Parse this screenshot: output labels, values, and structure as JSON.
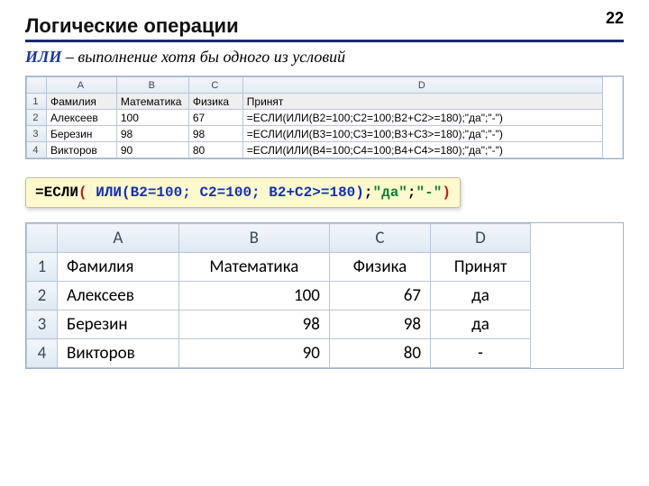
{
  "page_number": "22",
  "title": "Логические операции",
  "subtitle": {
    "keyword": "ИЛИ",
    "rest": " – выполнение хотя бы одного из условий"
  },
  "table_small": {
    "columns": [
      "A",
      "B",
      "C",
      "D"
    ],
    "headers": [
      "Фамилия",
      "Математика",
      "Физика",
      "Принят"
    ],
    "rows": [
      {
        "n": "1"
      },
      {
        "n": "2",
        "a": "Алексеев",
        "b": "100",
        "c": "67",
        "d": "=ЕСЛИ(ИЛИ(B2=100;C2=100;B2+C2>=180);\"да\";\"-\")"
      },
      {
        "n": "3",
        "a": "Березин",
        "b": "98",
        "c": "98",
        "d": "=ЕСЛИ(ИЛИ(B3=100;C3=100;B3+C3>=180);\"да\";\"-\")"
      },
      {
        "n": "4",
        "a": "Викторов",
        "b": "90",
        "c": "80",
        "d": "=ЕСЛИ(ИЛИ(B4=100;C4=100;B4+C4>=180);\"да\";\"-\")"
      }
    ]
  },
  "formula": {
    "t1": "=ЕСЛИ",
    "p1": "( ",
    "args": "ИЛИ(B2=100; C2=100; B2+C2>=180)",
    "t2": ";",
    "s1": "\"да\"",
    "t3": ";",
    "s2": "\"-\"",
    "p2": ")"
  },
  "table_big": {
    "columns": [
      "A",
      "B",
      "C",
      "D"
    ],
    "headers": [
      "Фамилия",
      "Математика",
      "Физика",
      "Принят"
    ],
    "rows": [
      {
        "n": "1"
      },
      {
        "n": "2",
        "a": "Алексеев",
        "b": "100",
        "c": "67",
        "d": "да"
      },
      {
        "n": "3",
        "a": "Березин",
        "b": "98",
        "c": "98",
        "d": "да"
      },
      {
        "n": "4",
        "a": "Викторов",
        "b": "90",
        "c": "80",
        "d": "-"
      }
    ]
  }
}
